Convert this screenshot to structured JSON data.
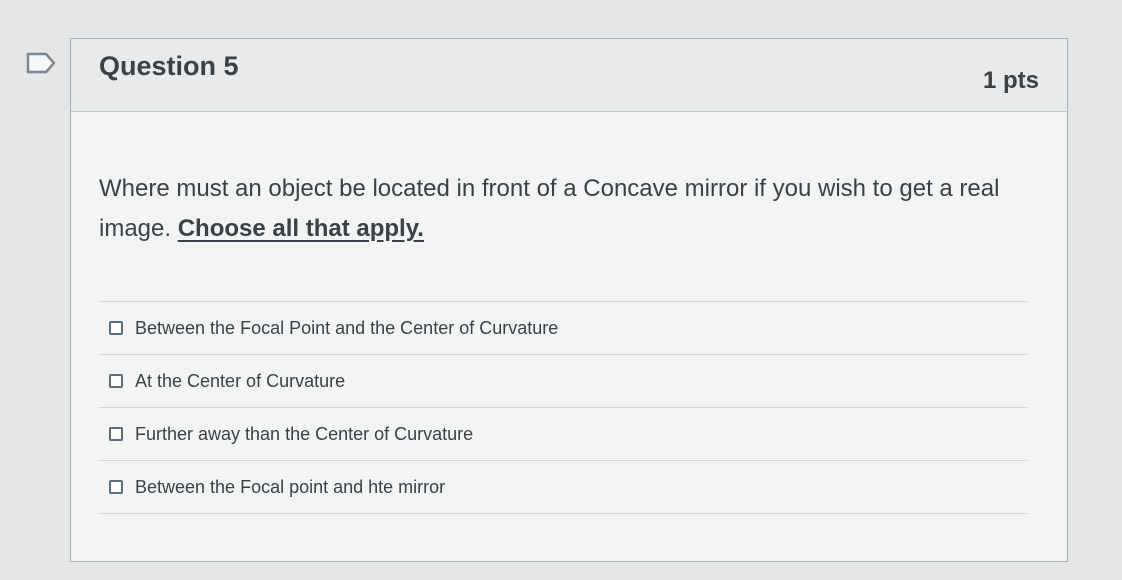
{
  "question": {
    "title": "Question 5",
    "points": "1 pts",
    "prompt_text": "Where must an object be located in front of a Concave mirror if you wish to get a real image. ",
    "prompt_emphasis": "Choose all that apply."
  },
  "answers": [
    {
      "label": "Between the Focal Point and the Center of Curvature",
      "checked": false
    },
    {
      "label": "At the Center of Curvature",
      "checked": false
    },
    {
      "label": "Further away than the Center of Curvature",
      "checked": false
    },
    {
      "label": "Between the Focal point and hte mirror",
      "checked": false
    }
  ],
  "colors": {
    "flag_outline": "#7b8793",
    "text": "#3a4148"
  },
  "icons": {
    "flag": "flag-question-icon",
    "checkbox": "checkbox-icon"
  }
}
